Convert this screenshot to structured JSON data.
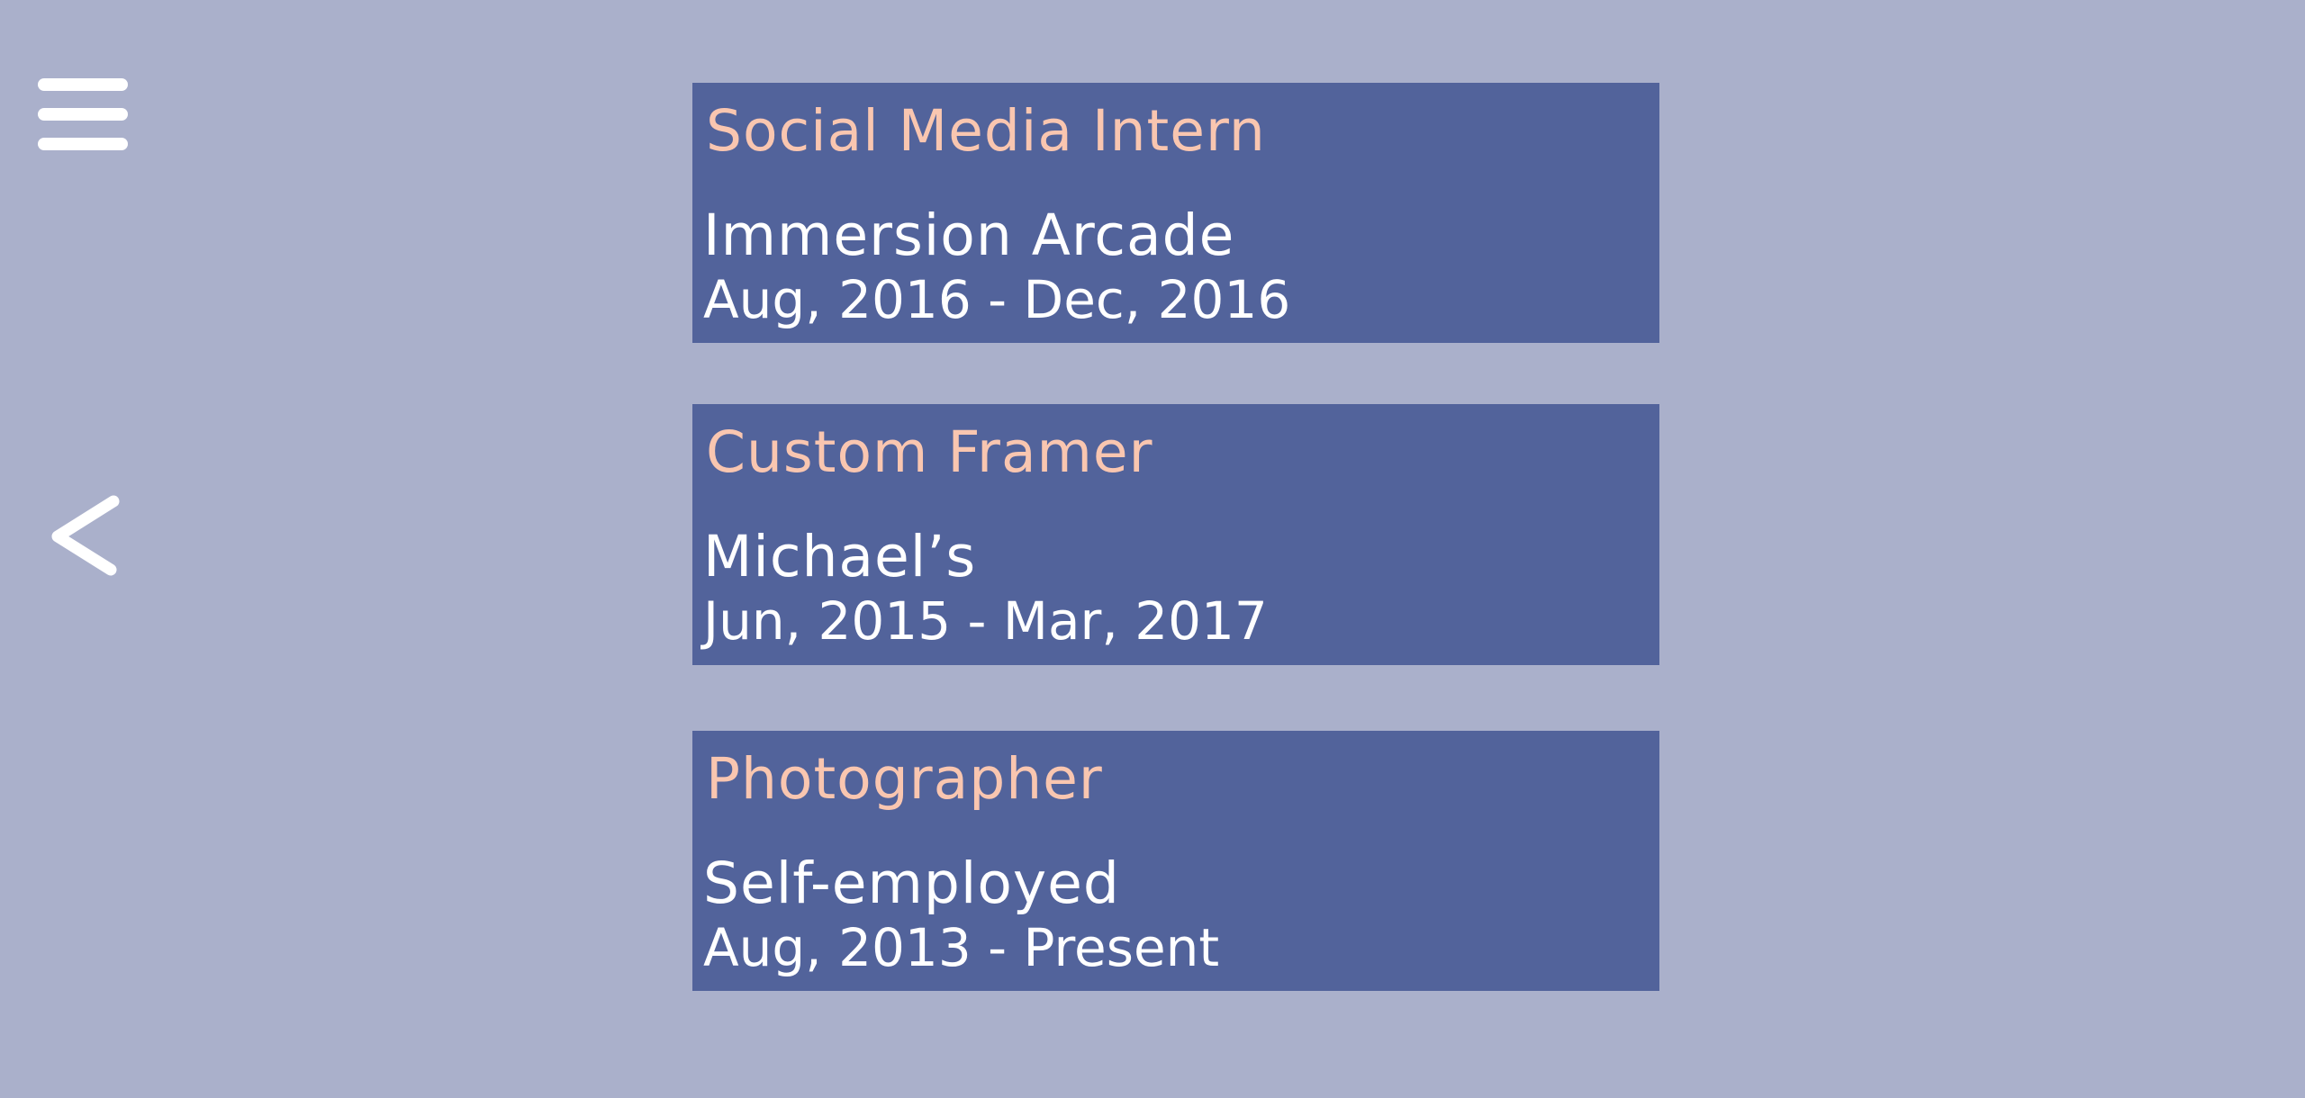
{
  "nav": {
    "menu_icon": "hamburger-menu-icon",
    "back_icon": "chevron-left-icon"
  },
  "colors": {
    "background": "#aab0cb",
    "card": "#52639b",
    "title_accent": "#f9c6b0",
    "text": "#ffffff"
  },
  "jobs": [
    {
      "title": "Social Media Intern",
      "company": "Immersion Arcade",
      "dates": "Aug, 2016 - Dec, 2016"
    },
    {
      "title": "Custom Framer",
      "company": "Michael’s",
      "dates": "Jun, 2015 - Mar, 2017"
    },
    {
      "title": "Photographer",
      "company": "Self-employed",
      "dates": "Aug, 2013 - Present"
    }
  ]
}
